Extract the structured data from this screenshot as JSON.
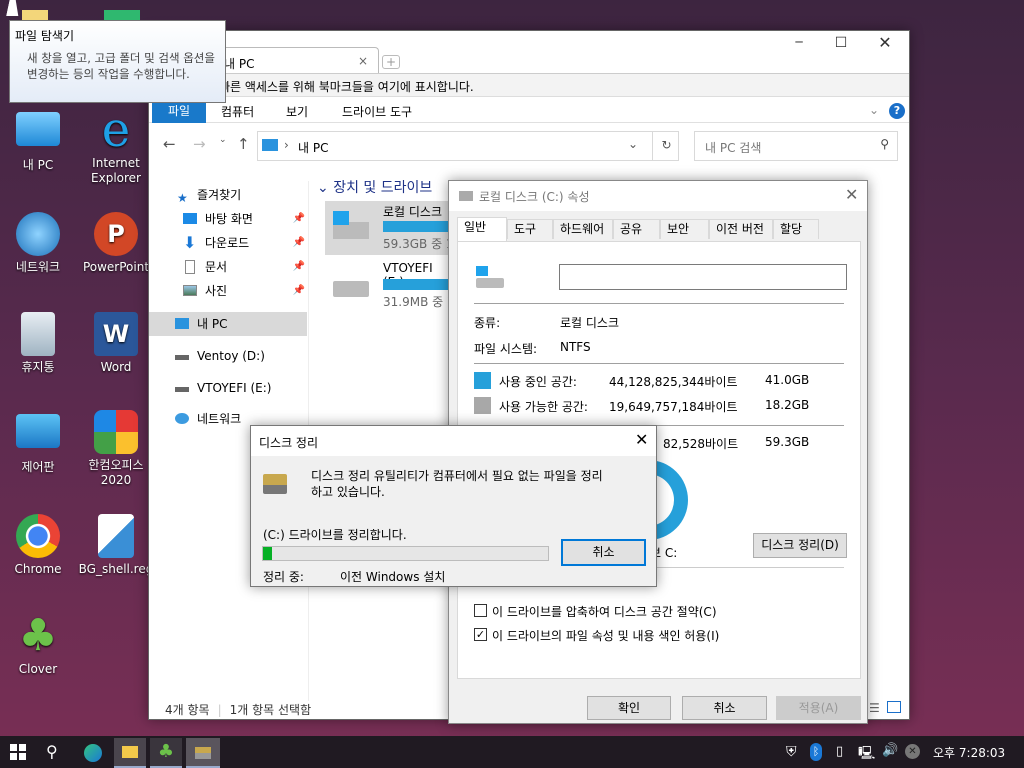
{
  "tooltip": {
    "title": "파일 탐색기",
    "body": "새 창을 열고, 고급 폴더 및 검색 옵션을 변경하는 등의 작업을 수행합니다."
  },
  "desktop_icons": [
    {
      "label": "내 PC",
      "icon": "computer-icon"
    },
    {
      "label": "Internet Explorer",
      "icon": "ie-icon"
    },
    {
      "label": "네트워크",
      "icon": "network-icon"
    },
    {
      "label": "PowerPoint",
      "icon": "powerpoint-icon"
    },
    {
      "label": "휴지통",
      "icon": "recycle-bin-icon"
    },
    {
      "label": "Word",
      "icon": "word-icon"
    },
    {
      "label": "제어판",
      "icon": "control-panel-icon"
    },
    {
      "label": "한컴오피스 2020",
      "icon": "hancom-icon"
    },
    {
      "label": "Chrome",
      "icon": "chrome-icon"
    },
    {
      "label": "BG_shell.reg",
      "icon": "reg-file-icon"
    },
    {
      "label": "Clover",
      "icon": "clover-icon"
    }
  ],
  "explorer": {
    "tab_title": "내 PC",
    "bookmark_bar": "빠른 액세스를 위해 북마크들을 여기에 표시합니다.",
    "ribbon_tabs": [
      "파일",
      "컴퓨터",
      "보기",
      "드라이브 도구"
    ],
    "address": "내 PC",
    "search_placeholder": "내 PC 검색",
    "nav": {
      "quick_access": "즐겨찾기",
      "desktop": "바탕 화면",
      "downloads": "다운로드",
      "documents": "문서",
      "pictures": "사진",
      "this_pc": "내 PC",
      "ventoy": "Ventoy (D:)",
      "vtoyefi": "VTOYEFI (E:)",
      "network": "네트워크"
    },
    "section": "장치 및 드라이브",
    "drives": [
      {
        "name": "로컬 디스크",
        "size": "59.3GB 중 1",
        "fill": 0.69
      },
      {
        "name": "VTOYEFI (E:)",
        "size": "31.9MB 중 7",
        "fill": 0.78
      }
    ],
    "status_count": "4개 항목",
    "status_selected": "1개 항목 선택함"
  },
  "props": {
    "title": "로컬 디스크 (C:) 속성",
    "tabs": [
      "일반",
      "도구",
      "하드웨어",
      "공유",
      "보안",
      "이전 버전",
      "할당량"
    ],
    "name_value": "",
    "type_label": "종류:",
    "type_value": "로컬 디스크",
    "fs_label": "파일 시스템:",
    "fs_value": "NTFS",
    "used_label": "사용 중인 공간:",
    "used_bytes": "44,128,825,344바이트",
    "used_gb": "41.0GB",
    "free_label": "사용 가능한 공간:",
    "free_bytes": "19,649,757,184바이트",
    "free_gb": "18.2GB",
    "cap_bytes": "82,528바이트",
    "cap_gb": "59.3GB",
    "drive_label": "브 C:",
    "cleanup_btn": "디스크 정리(D)",
    "compress": "이 드라이브를 압축하여 디스크 공간 절약(C)",
    "index": "이 드라이브의 파일 속성 및 내용 색인 허용(I)",
    "compress_checked": false,
    "index_checked": true,
    "ok": "확인",
    "cancel": "취소",
    "apply": "적용(A)",
    "colors": {
      "used": "#26a0da",
      "free": "#a8a8a8"
    }
  },
  "cleanup": {
    "title": "디스크 정리",
    "message": "디스크 정리 유틸리티가 컴퓨터에서 필요 없는 파일을 정리하고 있습니다.",
    "drive_msg": "(C:) 드라이브를 정리합니다.",
    "progress": 0.03,
    "status_label": "정리 중:",
    "status_value": "이전 Windows 설치",
    "cancel": "취소"
  },
  "taskbar": {
    "clock": "오후 7:28:03"
  }
}
